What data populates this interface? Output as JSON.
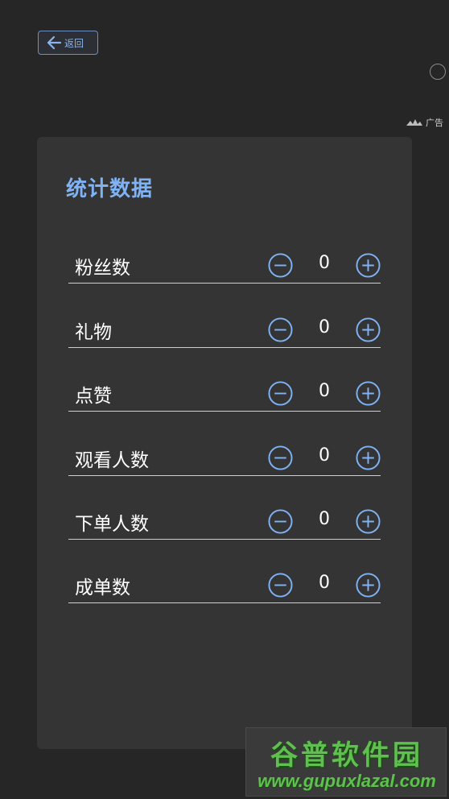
{
  "header": {
    "back_label": "返回"
  },
  "ad": {
    "label": "广告"
  },
  "card": {
    "title": "统计数据",
    "rows": [
      {
        "label": "粉丝数",
        "value": "0"
      },
      {
        "label": "礼物",
        "value": "0"
      },
      {
        "label": "点赞",
        "value": "0"
      },
      {
        "label": "观看人数",
        "value": "0"
      },
      {
        "label": "下单人数",
        "value": "0"
      },
      {
        "label": "成单数",
        "value": "0"
      }
    ]
  },
  "watermark": {
    "title": "谷普软件园",
    "url": "www.gupuxlazal.com"
  },
  "icons": {
    "back": "arrow-left-icon",
    "minus": "minus-circle-icon",
    "plus": "plus-circle-icon",
    "ad_logo": "ad-logo-icon"
  },
  "colors": {
    "accent": "#7fb3f5",
    "background": "#262626",
    "card": "#343434",
    "watermark": "#5fc04f"
  }
}
